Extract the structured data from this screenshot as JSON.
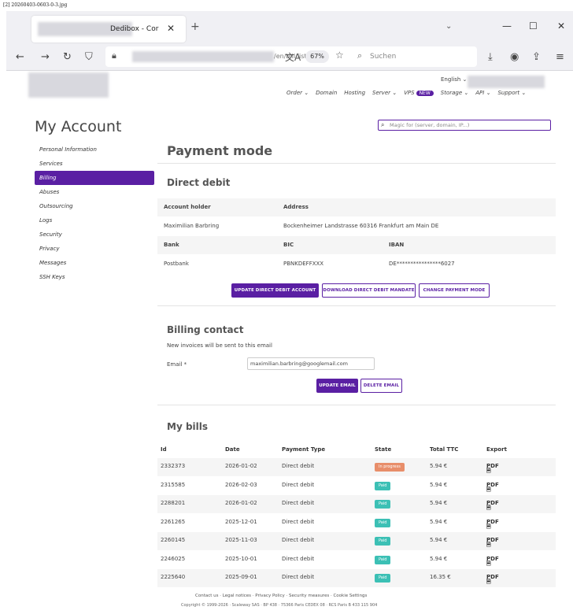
{
  "caption": "[2] 20260403-0603-0-3.jpg",
  "browser": {
    "tab_title": "Dedibox - Cor",
    "tab_close": "✕",
    "new_tab": "+",
    "url_text": "/en/bill/list",
    "zoom": "67%",
    "search_placeholder": "Suchen"
  },
  "header": {
    "language": "English",
    "nav": [
      "Order",
      "Domain",
      "Hosting",
      "Server",
      "VPS",
      "Storage",
      "API",
      "Support"
    ],
    "new_badge": "NEW"
  },
  "account": {
    "title": "My Account",
    "search_placeholder": "Magic for (server, domain, IP...)"
  },
  "sidebar": {
    "items": [
      {
        "label": "Personal Information"
      },
      {
        "label": "Services"
      },
      {
        "label": "Billing"
      },
      {
        "label": "Abuses"
      },
      {
        "label": "Outsourcing"
      },
      {
        "label": "Logs"
      },
      {
        "label": "Security"
      },
      {
        "label": "Privacy"
      },
      {
        "label": "Messages"
      },
      {
        "label": "SSH Keys"
      }
    ]
  },
  "payment": {
    "title": "Payment mode",
    "direct_debit": {
      "title": "Direct debit",
      "account_holder_label": "Account holder",
      "address_label": "Address",
      "account_holder": "Maximilian Barbring",
      "address": "Bockenheimer Landstrasse 60316 Frankfurt am Main DE",
      "bank_label": "Bank",
      "bic_label": "BIC",
      "iban_label": "IBAN",
      "bank": "Postbank",
      "bic": "PBNKDEFFXXX",
      "iban": "DE****************6027",
      "btn_update": "UPDATE DIRECT DEBIT ACCOUNT",
      "btn_download": "DOWNLOAD DIRECT DEBIT MANDATE",
      "btn_change": "CHANGE PAYMENT MODE"
    }
  },
  "billing_contact": {
    "title": "Billing contact",
    "note": "New invoices will be sent to this email",
    "email_label": "Email *",
    "email_value": "maximilian.barbring@googlemail.com",
    "btn_update": "UPDATE EMAIL",
    "btn_delete": "DELETE EMAIL"
  },
  "bills": {
    "title": "My bills",
    "columns": [
      "Id",
      "Date",
      "Payment Type",
      "State",
      "Total TTC",
      "Export"
    ],
    "rows": [
      {
        "id": "2332373",
        "date": "2026-01-02",
        "type": "Direct debit",
        "state": "In progress",
        "state_kind": "pending",
        "total": "5.94 €",
        "export": "PDF"
      },
      {
        "id": "2315585",
        "date": "2026-02-03",
        "type": "Direct debit",
        "state": "Paid",
        "state_kind": "paid",
        "total": "5.94 €",
        "export": "PDF"
      },
      {
        "id": "2288201",
        "date": "2026-01-02",
        "type": "Direct debit",
        "state": "Paid",
        "state_kind": "paid",
        "total": "5.94 €",
        "export": "PDF"
      },
      {
        "id": "2261265",
        "date": "2025-12-01",
        "type": "Direct debit",
        "state": "Paid",
        "state_kind": "paid",
        "total": "5.94 €",
        "export": "PDF"
      },
      {
        "id": "2260145",
        "date": "2025-11-03",
        "type": "Direct debit",
        "state": "Paid",
        "state_kind": "paid",
        "total": "5.94 €",
        "export": "PDF"
      },
      {
        "id": "2246025",
        "date": "2025-10-01",
        "type": "Direct debit",
        "state": "Paid",
        "state_kind": "paid",
        "total": "5.94 €",
        "export": "PDF"
      },
      {
        "id": "2225640",
        "date": "2025-09-01",
        "type": "Direct debit",
        "state": "Paid",
        "state_kind": "paid",
        "total": "16.35 €",
        "export": "PDF"
      }
    ]
  },
  "footer": {
    "links": "Contact us · Legal notices · Privacy Policy · Security measures · Cookie Settings",
    "copyright": "Copyright © 1999-2026 · Scaleway SAS · BP 438 · 75366 Paris CEDEX 08 · RCS Paris B 433 115 904"
  },
  "colors": {
    "accent": "#5a1fa3",
    "pending": "#e88e6a",
    "paid": "#3cc0b5"
  }
}
